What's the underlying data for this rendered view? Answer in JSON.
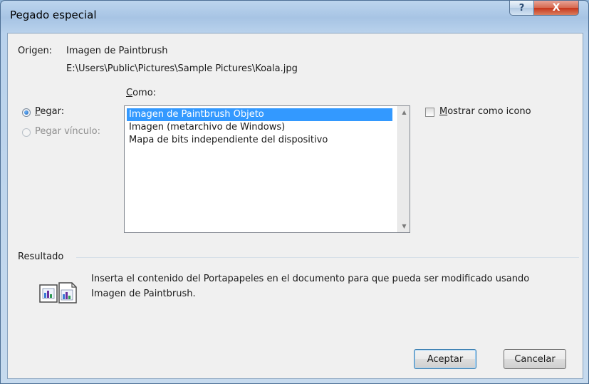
{
  "window": {
    "title": "Pegado especial",
    "help_glyph": "?",
    "close_glyph": "X"
  },
  "origen": {
    "label": "Origen:",
    "value": "Imagen de Paintbrush",
    "path": "E:\\Users\\Public\\Pictures\\Sample Pictures\\Koala.jpg"
  },
  "como": {
    "label": "Como:",
    "items": [
      {
        "label": "Imagen de Paintbrush Objeto",
        "selected": true
      },
      {
        "label": "Imagen (metarchivo de Windows)",
        "selected": false
      },
      {
        "label": "Mapa de bits independiente del dispositivo",
        "selected": false
      }
    ]
  },
  "options": {
    "pegar_label": "Pegar:",
    "pegar_selected": true,
    "vinculo_label": "Pegar vínculo:",
    "vinculo_enabled": false,
    "mostrar_label": "Mostrar como icono",
    "mostrar_checked": false
  },
  "resultado": {
    "label": "Resultado",
    "line1": "Inserta el contenido del Portapapeles en el documento para que pueda ser modificado usando",
    "line2": "Imagen de Paintbrush.",
    "icon": "paste-object-icon"
  },
  "buttons": {
    "ok": "Aceptar",
    "cancel": "Cancelar"
  },
  "colors": {
    "selection": "#3399ff",
    "title_bar": "#a7c4e4",
    "close_button": "#c7361b"
  }
}
